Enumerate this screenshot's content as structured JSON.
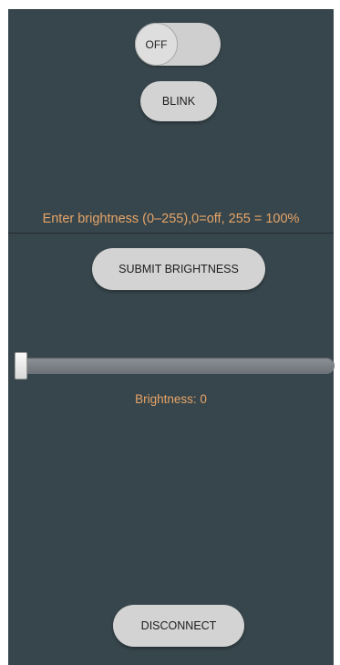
{
  "toggle": {
    "state_label": "OFF",
    "is_on": false
  },
  "buttons": {
    "blink_label": "BLINK",
    "submit_label": "SUBMIT BRIGHTNESS",
    "disconnect_label": "DISCONNECT"
  },
  "brightness_input": {
    "value": "",
    "placeholder": "Enter brightness (0–255),0=off, 255 = 100%"
  },
  "slider": {
    "value": 0,
    "min": 0,
    "max": 255
  },
  "readout": {
    "text": "Brightness: 0"
  },
  "colors": {
    "background": "#37464c",
    "accent_text": "#e7a467",
    "button": "#d3d3d3"
  }
}
